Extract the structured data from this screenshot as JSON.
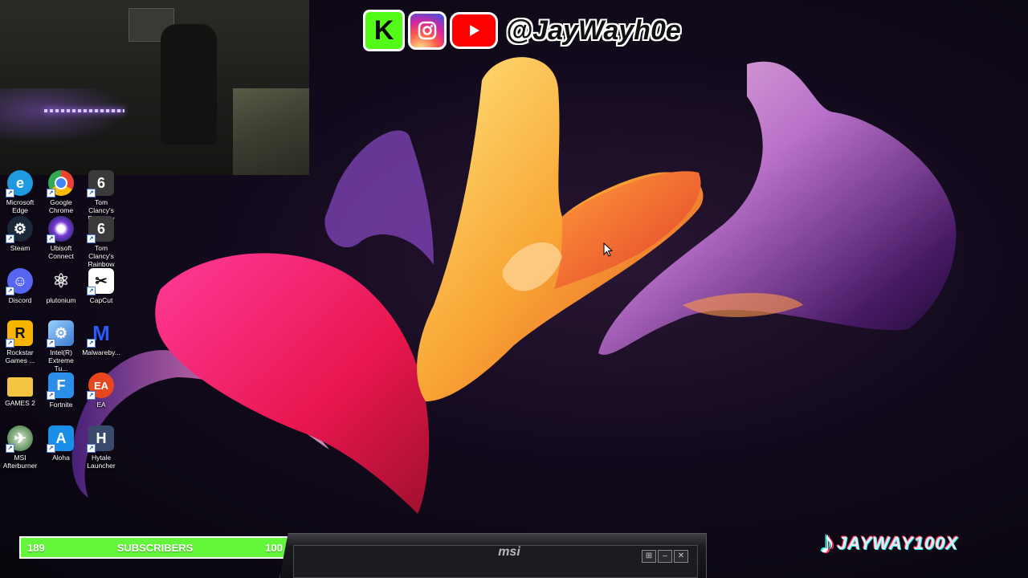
{
  "social": {
    "kick_letter": "K",
    "handle": "@JayWayh0e"
  },
  "desktop_icons": [
    {
      "id": "edge",
      "label": "Microsoft Edge",
      "color": "#1f9ae0",
      "glyph": "e"
    },
    {
      "id": "chrome",
      "label": "Google Chrome",
      "color": "#e8a33b",
      "glyph": "●"
    },
    {
      "id": "rainbow1",
      "label": "Tom Clancy's Rainbow Si...",
      "color": "#3a3a3a",
      "glyph": "6"
    },
    {
      "id": "steam",
      "label": "Steam",
      "color": "#1b2838",
      "glyph": "⚙"
    },
    {
      "id": "ubisoft",
      "label": "Ubisoft Connect",
      "color": "#2c2c6a",
      "glyph": "◎"
    },
    {
      "id": "rainbow2",
      "label": "Tom Clancy's Rainbow Si...",
      "color": "#3a3a3a",
      "glyph": "6"
    },
    {
      "id": "discord",
      "label": "Discord",
      "color": "#5865f2",
      "glyph": "☺"
    },
    {
      "id": "plutonium",
      "label": "plutonium",
      "color": "#222",
      "glyph": "⚛"
    },
    {
      "id": "capcut",
      "label": "CapCut",
      "color": "#fff",
      "glyph": "✂"
    },
    {
      "id": "rockstar",
      "label": "Rockstar Games ...",
      "color": "#f7b400",
      "glyph": "R"
    },
    {
      "id": "intel",
      "label": "Intel(R) Extreme Tu...",
      "color": "#3a7ad0",
      "glyph": "⚙"
    },
    {
      "id": "malwarebytes",
      "label": "Malwareby...",
      "color": "#1c3ea8",
      "glyph": "M"
    },
    {
      "id": "games2",
      "label": "GAMES 2",
      "color": "#f4c542",
      "glyph": ""
    },
    {
      "id": "fortnite",
      "label": "Fortnite",
      "color": "#2b8ee8",
      "glyph": "F"
    },
    {
      "id": "ea",
      "label": "EA",
      "color": "#e8461e",
      "glyph": "EA"
    },
    {
      "id": "msi",
      "label": "MSI Afterburner",
      "color": "#2a6a2a",
      "glyph": "✈"
    },
    {
      "id": "aloha",
      "label": "Aloha",
      "color": "#1a8ee8",
      "glyph": "A"
    },
    {
      "id": "hytale",
      "label": "Hytale Launcher",
      "color": "#3a4a6a",
      "glyph": "H"
    }
  ],
  "subscribers": {
    "current": "189",
    "label": "SUBSCRIBERS",
    "goal": "100"
  },
  "taskbar": {
    "brand": "msi"
  },
  "tiktok": {
    "name": "JAYWAY100X"
  }
}
